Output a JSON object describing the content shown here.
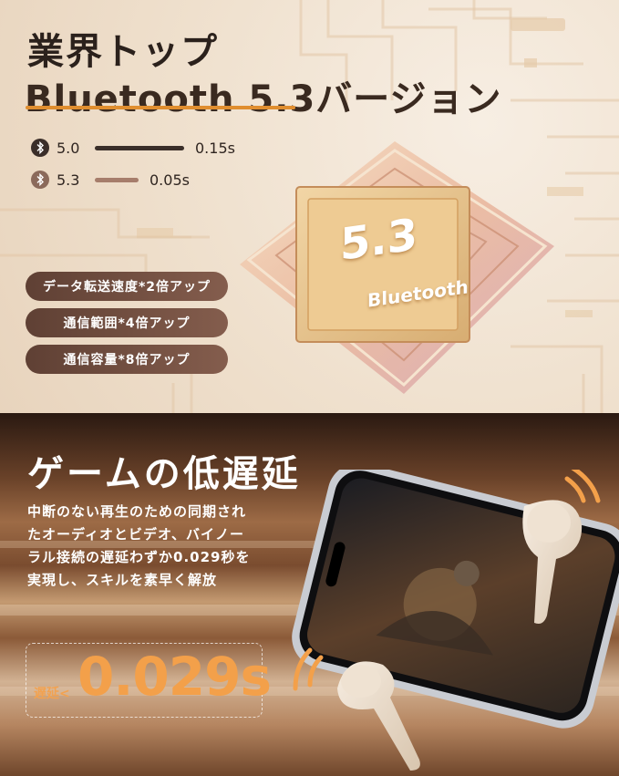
{
  "header": {
    "title_line1": "業界トップ",
    "title_line2": "Bluetooth 5.3バージョン"
  },
  "comparison": [
    {
      "version": "5.0",
      "latency": "0.15s",
      "bar_color": "#3a2e29"
    },
    {
      "version": "5.3",
      "latency": "0.05s",
      "bar_color": "#a67d6b"
    }
  ],
  "chip": {
    "version": "5.3",
    "label": "Bluetooth"
  },
  "features": [
    {
      "label": "データ転送速度*2倍アップ"
    },
    {
      "label": "通信範囲*4倍アップ"
    },
    {
      "label": "通信容量*8倍アップ"
    }
  ],
  "game": {
    "title": "ゲームの低遅延",
    "description_lines": [
      "中断のない再生のための同期され",
      "たオーディオとビデオ、バイノー",
      "ラル接続の遅延わずか0.029秒を",
      "実現し、スキルを素早く解放"
    ],
    "latency_label": "遅延<",
    "latency_value": "0.029s"
  },
  "icons": [
    "bluetooth-icon",
    "sound-wave-icon"
  ],
  "colors": {
    "accent": "#e08e2f",
    "latency": "#f3a04a",
    "pill": "#6e4c3e"
  }
}
